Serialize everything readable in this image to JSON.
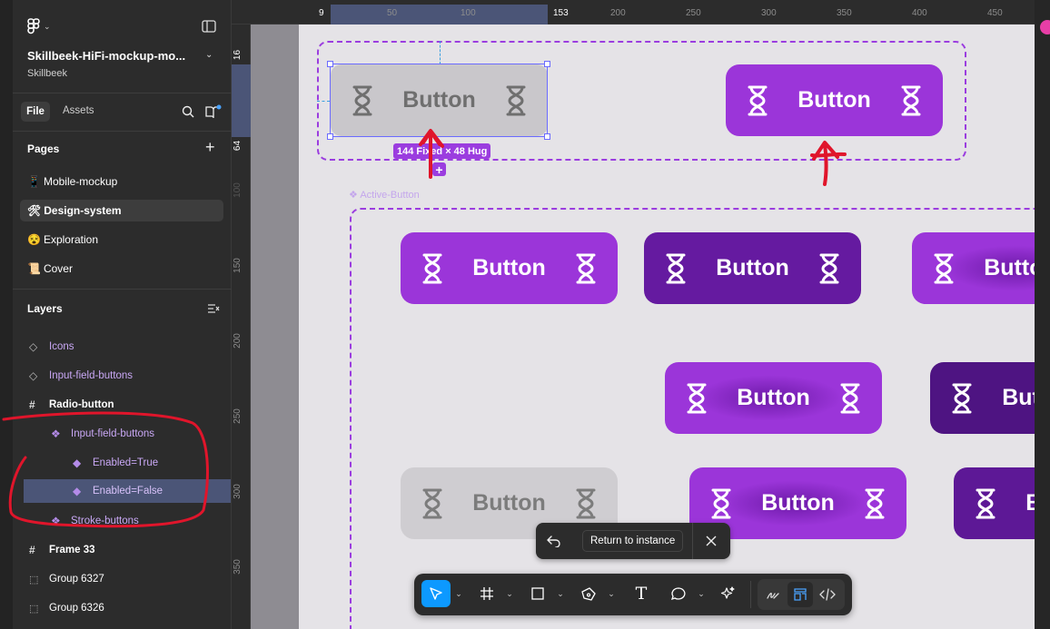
{
  "file": {
    "name": "Skillbeek-HiFi-mockup-mo...",
    "team": "Skillbeek"
  },
  "sidebar_tabs": {
    "file": "File",
    "assets": "Assets"
  },
  "pages": {
    "title": "Pages",
    "items": [
      {
        "emoji": "📱",
        "label": "Mobile-mockup"
      },
      {
        "emoji": "🛠",
        "label": "Design-system",
        "selected": true
      },
      {
        "emoji": "😵",
        "label": "Exploration"
      },
      {
        "emoji": "📜",
        "label": "Cover"
      }
    ]
  },
  "layers": {
    "title": "Layers",
    "items": [
      {
        "icon": "component-set-icon",
        "label": "Icons"
      },
      {
        "icon": "component-set-icon",
        "label": "Input-field-buttons"
      },
      {
        "icon": "frame-icon",
        "label": "Radio-button"
      },
      {
        "icon": "component-set-icon",
        "label": "Input-field-buttons"
      },
      {
        "icon": "component-icon",
        "label": "Enabled=True"
      },
      {
        "icon": "component-icon",
        "label": "Enabled=False",
        "selected": true
      },
      {
        "icon": "component-set-icon",
        "label": "Stroke-buttons"
      },
      {
        "icon": "frame-icon",
        "label": "Frame 33"
      },
      {
        "icon": "group-icon",
        "label": "Group 6327"
      },
      {
        "icon": "group-icon",
        "label": "Group 6326"
      }
    ]
  },
  "ruler": {
    "h_ticks": [
      "9",
      "50",
      "100",
      "153",
      "200",
      "250",
      "300",
      "350",
      "400",
      "450"
    ],
    "v_ticks": [
      "16",
      "64",
      "100",
      "150",
      "200",
      "250",
      "300",
      "350"
    ]
  },
  "canvas": {
    "button_label": "Button",
    "size_label": "144 Fixed × 48 Hug",
    "section_label": "Active-Button"
  },
  "return_bar": {
    "label": "Return to instance"
  },
  "toolbar": [
    "move-tool",
    "frame-tool",
    "shape-tool",
    "pen-tool",
    "text-tool",
    "comment-tool",
    "actions-tool",
    "draw-mode",
    "design-mode",
    "dev-mode"
  ],
  "colors": {
    "accent": "#9b35d9",
    "accent_dark": "#651aa0",
    "disabled": "#c9c7cb",
    "annotation": "#e0152b"
  }
}
